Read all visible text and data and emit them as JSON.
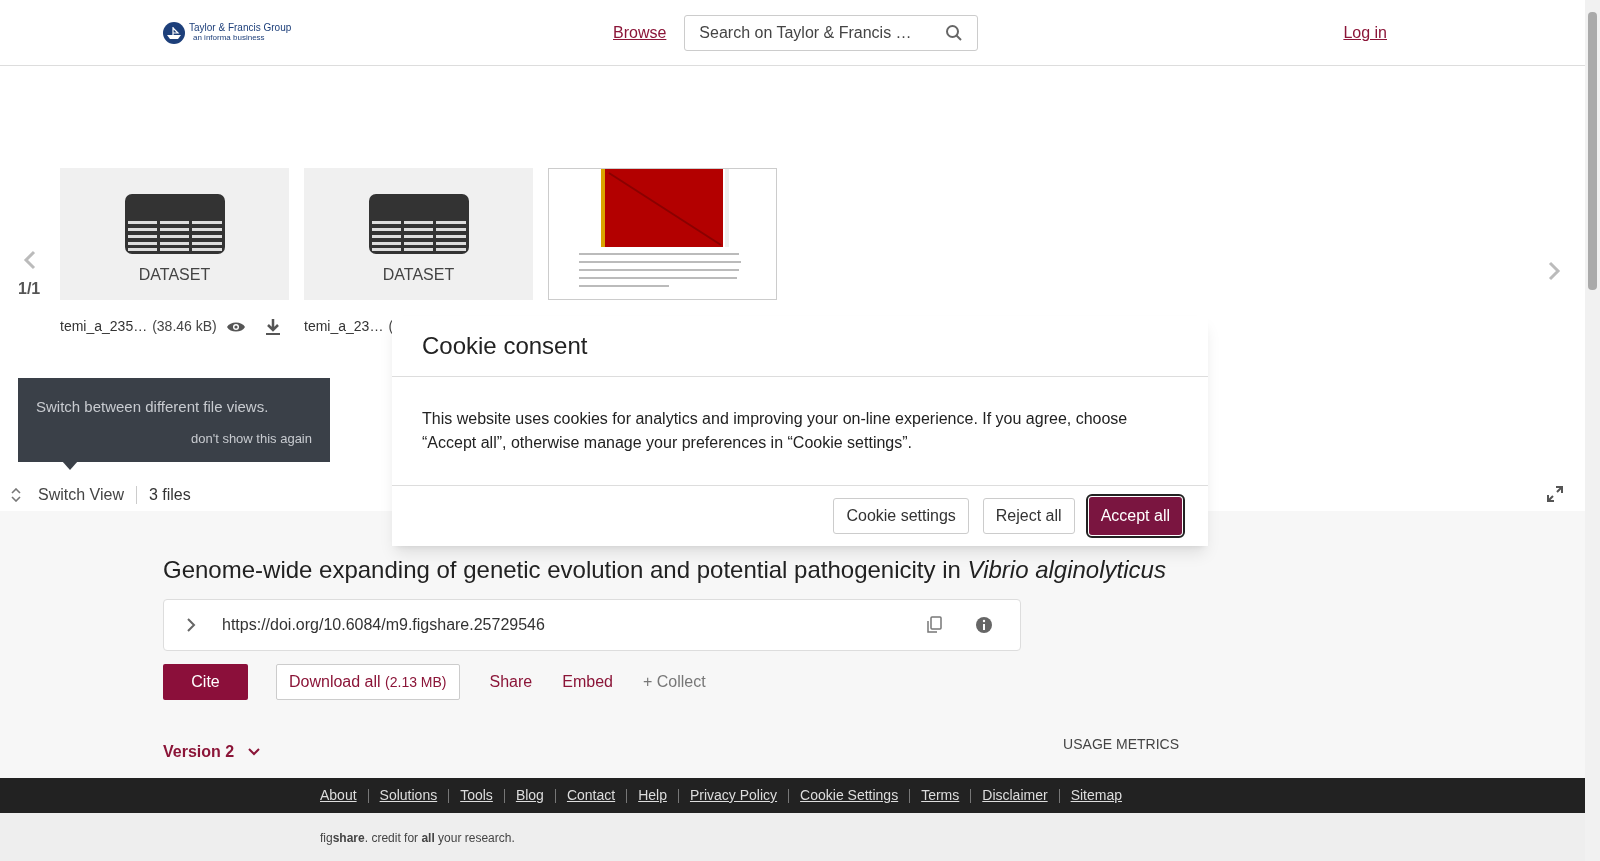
{
  "header": {
    "logo": {
      "title": "Taylor & Francis Group",
      "subtitle": "an informa business"
    },
    "browse": "Browse",
    "search": {
      "placeholder": "Search on Taylor & Francis …"
    },
    "login": "Log in"
  },
  "carousel": {
    "page": "1/1",
    "files": [
      {
        "kind": "dataset",
        "label": "DATASET",
        "name": "temi_a_235…",
        "size": "(38.46 kB)",
        "viewable": true,
        "downloadable": true
      },
      {
        "kind": "dataset",
        "label": "DATASET",
        "name": "temi_a_23…",
        "size": "("
      },
      {
        "kind": "picture"
      }
    ]
  },
  "tooltip": {
    "text": "Switch between different file views.",
    "dismiss": "don't show this again"
  },
  "toolbar": {
    "switch_view": "Switch View",
    "count": "3 files"
  },
  "article": {
    "title": "Genome-wide expanding of genetic evolution and potential pathogenicity in *Vibrio alginolyticus*",
    "doi": "https://doi.org/10.6084/m9.figshare.25729546",
    "actions": [
      {
        "kind": "primary",
        "label": "Cite"
      },
      {
        "kind": "outline",
        "label": "Download all",
        "extra": "(2.13 MB)"
      },
      {
        "kind": "link",
        "label": "Share"
      },
      {
        "kind": "link",
        "label": "Embed"
      },
      {
        "kind": "muted",
        "label": "+ Collect"
      }
    ],
    "version": "Version 2",
    "usage": "USAGE METRICS"
  },
  "footer": {
    "links": [
      "About",
      "Solutions",
      "Tools",
      "Blog",
      "Contact",
      "Help",
      "Privacy Policy",
      "Cookie Settings",
      "Terms",
      "Disclaimer",
      "Sitemap"
    ],
    "tagline": "fig**share**. credit for **all** your research."
  },
  "modal": {
    "title": "Cookie consent",
    "body": "This website uses cookies for analytics and improving your on-line experience. If you agree, choose “Accept all”, otherwise manage your preferences in “Cookie settings”.",
    "buttons": [
      {
        "kind": "secondary",
        "label": "Cookie settings"
      },
      {
        "kind": "secondary",
        "label": "Reject all"
      },
      {
        "kind": "primary",
        "label": "Accept all"
      }
    ]
  }
}
